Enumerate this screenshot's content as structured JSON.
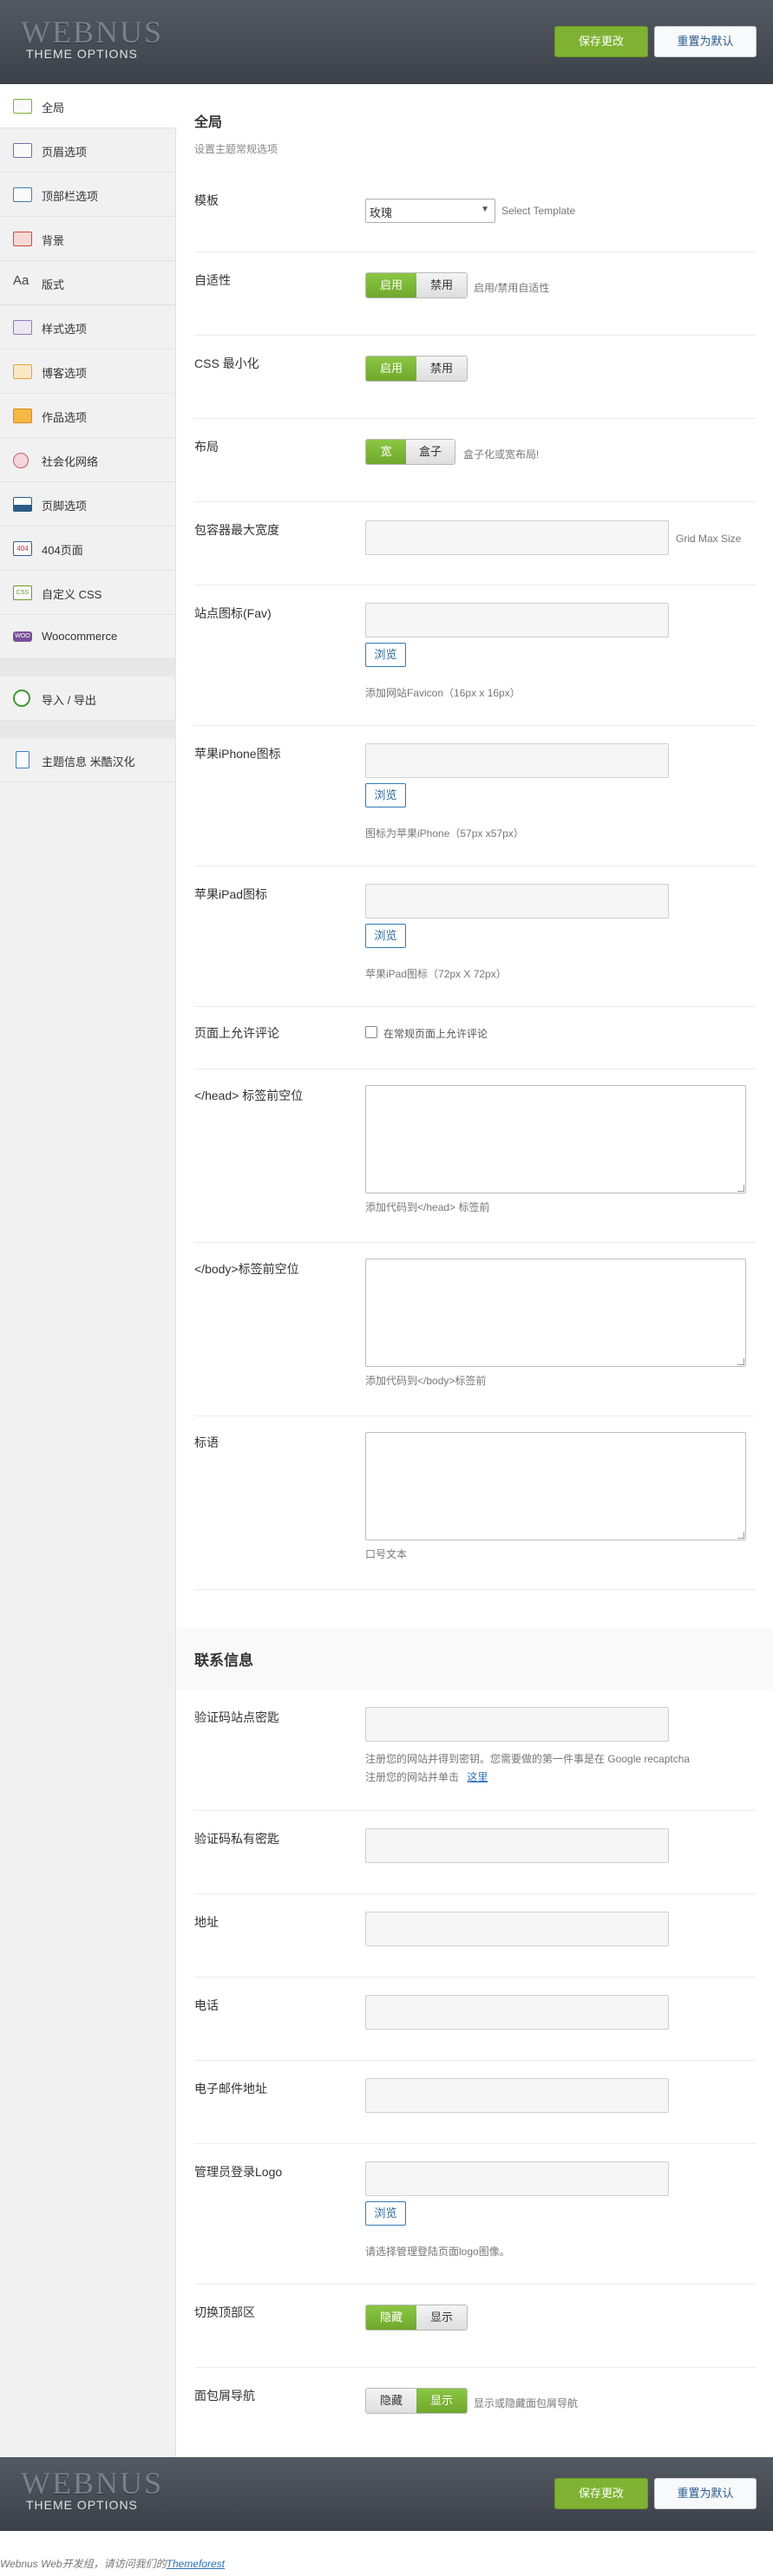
{
  "header": {
    "logo": "WEBNUS",
    "subtitle": "THEME OPTIONS",
    "save_label": "保存更改",
    "reset_label": "重置为默认"
  },
  "sidebar": {
    "items": [
      {
        "label": "全局",
        "icon": "globe-icon"
      },
      {
        "label": "页眉选项",
        "icon": "header-icon"
      },
      {
        "label": "顶部栏选项",
        "icon": "topbar-icon"
      },
      {
        "label": "背景",
        "icon": "background-icon"
      },
      {
        "label": "版式",
        "icon": "typography-icon"
      },
      {
        "label": "样式选项",
        "icon": "style-icon"
      },
      {
        "label": "博客选项",
        "icon": "blog-icon"
      },
      {
        "label": "作品选项",
        "icon": "portfolio-icon"
      },
      {
        "label": "社会化网络",
        "icon": "social-icon"
      },
      {
        "label": "页脚选项",
        "icon": "footer-icon"
      },
      {
        "label": "404页面",
        "icon": "404-icon"
      },
      {
        "label": "自定义 CSS",
        "icon": "css-icon"
      },
      {
        "label": "Woocommerce",
        "icon": "woo-icon"
      },
      {
        "label": "导入 / 导出",
        "icon": "import-export-icon"
      },
      {
        "label": "主题信息 米酷汉化",
        "icon": "theme-info-icon"
      }
    ]
  },
  "general": {
    "title": "全局",
    "desc": "设置主题常规选项",
    "template": {
      "label": "模板",
      "value": "玫瑰",
      "hint": "Select Template"
    },
    "responsive": {
      "label": "自适性",
      "on": "启用",
      "off": "禁用",
      "hint": "启用/禁用自适性"
    },
    "css_min": {
      "label": "CSS 最小化",
      "on": "启用",
      "off": "禁用"
    },
    "layout": {
      "label": "布局",
      "on": "宽",
      "off": "盒子",
      "hint": "盒子化或宽布局!"
    },
    "container": {
      "label": "包容器最大宽度",
      "hint": "Grid Max Size"
    },
    "favicon": {
      "label": "站点图标(Fav)",
      "browse": "浏览",
      "hint": "添加网站Favicon（16px x 16px）"
    },
    "iphone": {
      "label": "苹果iPhone图标",
      "browse": "浏览",
      "hint": "图标为苹果iPhone（57px x57px）"
    },
    "ipad": {
      "label": "苹果iPad图标",
      "browse": "浏览",
      "hint": "苹果iPad图标（72px X 72px）"
    },
    "comments": {
      "label": "页面上允许评论",
      "checkbox": "在常规页面上允许评论"
    },
    "head_code": {
      "label": "</head> 标签前空位",
      "hint": "添加代码到</head> 标签前"
    },
    "body_code": {
      "label": "</body>标签前空位",
      "hint": "添加代码到</body>标签前"
    },
    "slogan": {
      "label": "标语",
      "hint": "口号文本"
    }
  },
  "contact": {
    "title": "联系信息",
    "captcha_site": {
      "label": "验证码站点密匙",
      "hint1": "注册您的网站并得到密钥。您需要做的第一件事是在 Google recaptcha",
      "hint2": "注册您的网站并单击",
      "link": "这里"
    },
    "captcha_private": {
      "label": "验证码私有密匙"
    },
    "address": {
      "label": "地址"
    },
    "phone": {
      "label": "电话"
    },
    "email": {
      "label": "电子邮件地址"
    },
    "admin_logo": {
      "label": "管理员登录Logo",
      "browse": "浏览",
      "hint": "请选择管理登陆页面logo图像。"
    },
    "toggle_top": {
      "label": "切换顶部区",
      "on": "隐藏",
      "off": "显示"
    },
    "breadcrumb": {
      "label": "面包屑导航",
      "on": "隐藏",
      "off": "显示",
      "hint": "显示或隐藏面包屑导航"
    }
  },
  "footer": {
    "credit_prefix": "Webnus Web开发组，请访问我们的",
    "credit_link": "Themeforest"
  },
  "colors": {
    "accent": "#7fb233",
    "header_bg": "#464b53",
    "link": "#2a6fb8"
  }
}
